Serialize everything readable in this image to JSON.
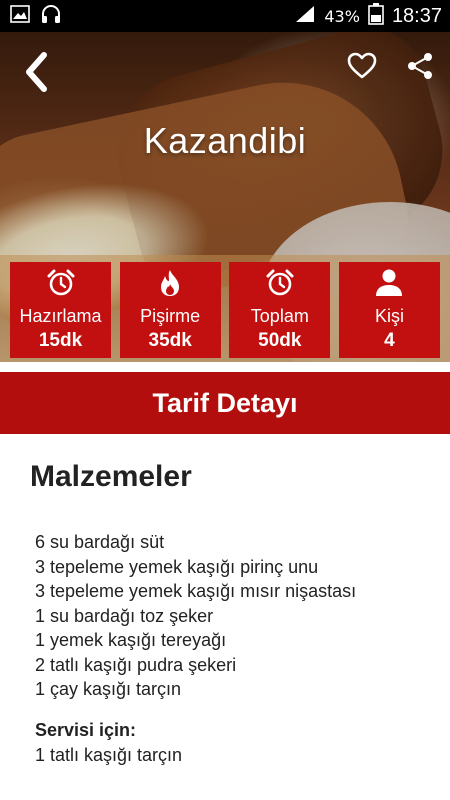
{
  "status_bar": {
    "battery": "43%",
    "time": "18:37"
  },
  "recipe": {
    "title": "Kazandibi"
  },
  "info": [
    {
      "label": "Hazırlama",
      "value": "15dk",
      "icon": "alarm-clock-icon"
    },
    {
      "label": "Pişirme",
      "value": "35dk",
      "icon": "flame-icon"
    },
    {
      "label": "Toplam",
      "value": "50dk",
      "icon": "alarm-clock-icon"
    },
    {
      "label": "Kişi",
      "value": "4",
      "icon": "person-icon"
    }
  ],
  "section": {
    "title": "Tarif Detayı"
  },
  "ingredients": {
    "title": "Malzemeler",
    "items": [
      "6 su bardağı süt",
      "3 tepeleme yemek kaşığı pirinç unu",
      "3 tepeleme yemek kaşığı mısır nişastası",
      "1 su bardağı toz şeker",
      "1 yemek kaşığı tereyağı",
      "2 tatlı kaşığı pudra şekeri",
      "1 çay kaşığı tarçın"
    ],
    "serving_title": "Servisi için:",
    "serving_items": [
      "1 tatlı kaşığı tarçın"
    ]
  },
  "colors": {
    "accent": "#c20f0f",
    "section_bar": "#b20e0e"
  }
}
